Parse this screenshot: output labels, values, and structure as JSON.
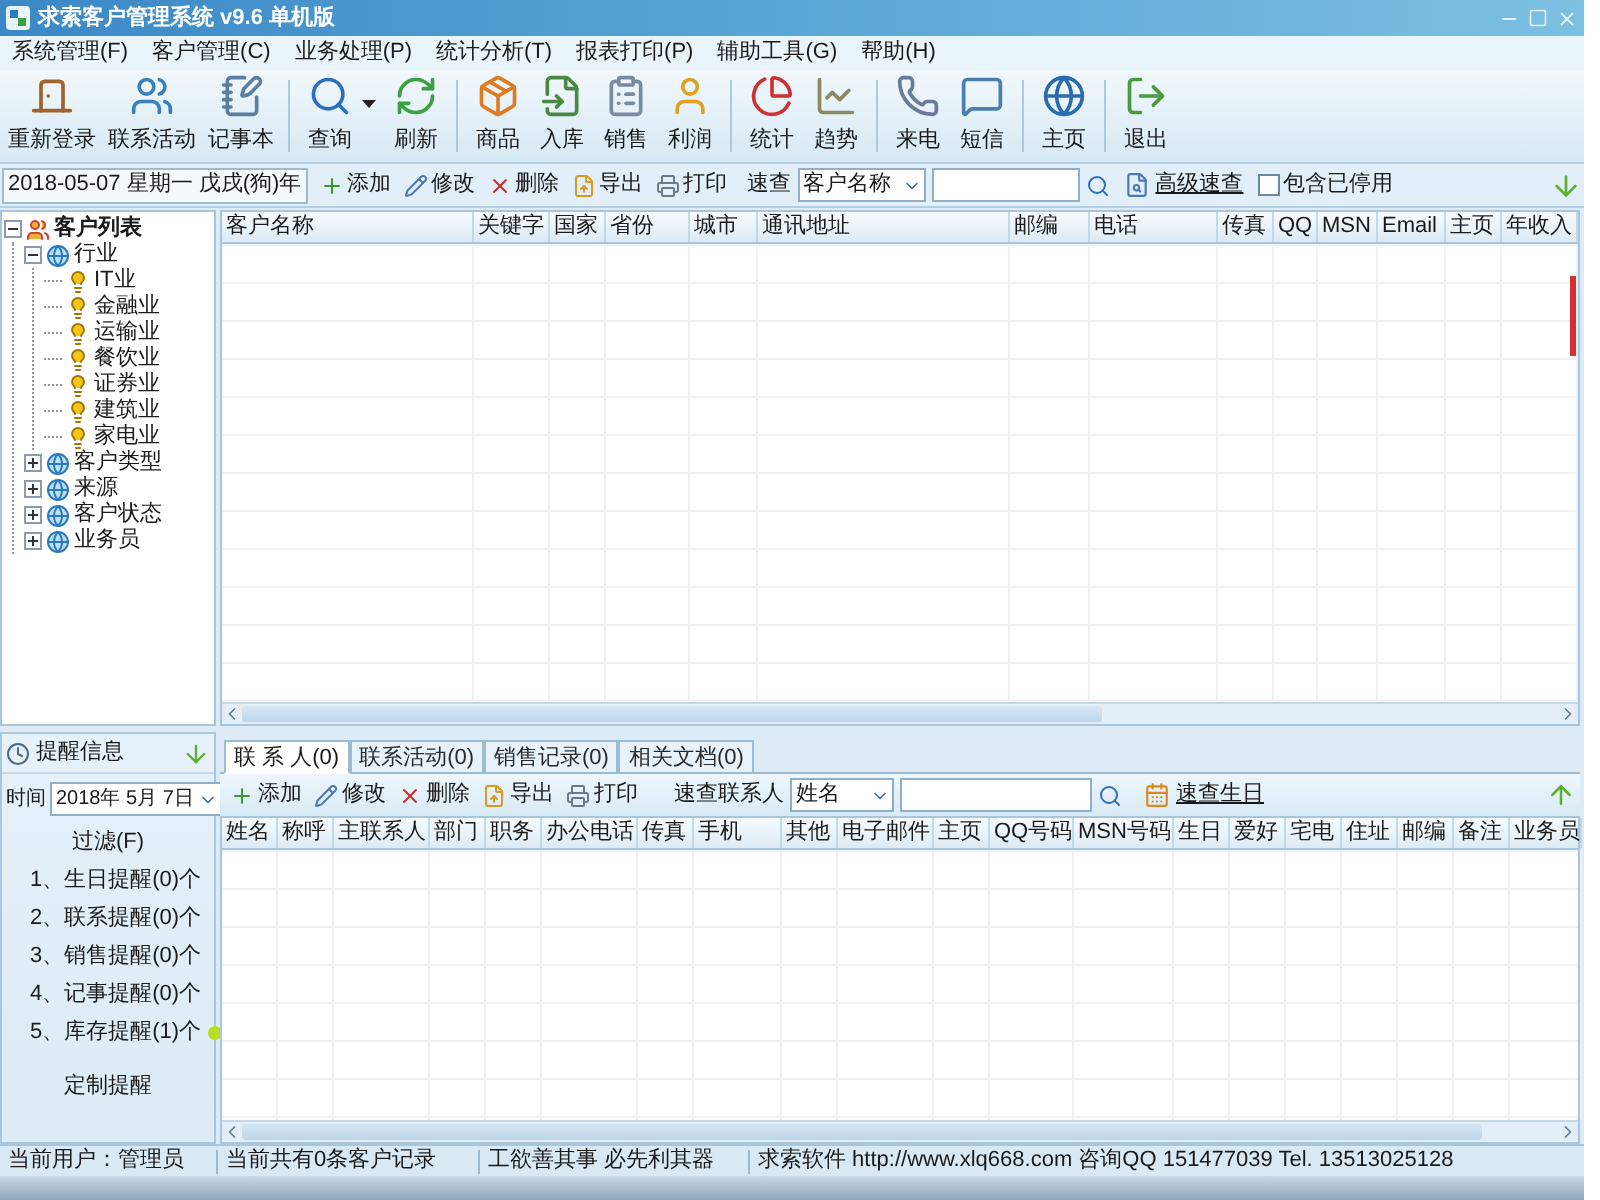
{
  "window": {
    "title": "求索客户管理系统 v9.6 单机版"
  },
  "menu": [
    "系统管理(F)",
    "客户管理(C)",
    "业务处理(P)",
    "统计分析(T)",
    "报表打印(P)",
    "辅助工具(G)",
    "帮助(H)"
  ],
  "toolbar": [
    {
      "items": [
        {
          "label": "重新登录",
          "dropdown": false
        },
        {
          "label": "联系活动",
          "dropdown": false
        },
        {
          "label": "记事本",
          "dropdown": false
        }
      ]
    },
    {
      "items": [
        {
          "label": "查询",
          "dropdown": true
        },
        {
          "label": "刷新",
          "dropdown": false
        }
      ]
    },
    {
      "items": [
        {
          "label": "商品",
          "dropdown": false
        },
        {
          "label": "入库",
          "dropdown": false
        },
        {
          "label": "销售",
          "dropdown": false
        },
        {
          "label": "利润",
          "dropdown": false
        }
      ]
    },
    {
      "items": [
        {
          "label": "统计",
          "dropdown": false
        },
        {
          "label": "趋势",
          "dropdown": false
        }
      ]
    },
    {
      "items": [
        {
          "label": "来电",
          "dropdown": false
        },
        {
          "label": "短信",
          "dropdown": false
        }
      ]
    },
    {
      "items": [
        {
          "label": "主页",
          "dropdown": false
        }
      ]
    },
    {
      "items": [
        {
          "label": "退出",
          "dropdown": false
        }
      ]
    }
  ],
  "filter_bar": {
    "date": "2018-05-07 星期一 戊戌(狗)年",
    "actions": [
      "添加",
      "修改",
      "删除",
      "导出",
      "打印"
    ],
    "quick_search": {
      "label": "速查",
      "field": "客户名称"
    },
    "advanced_search": "高级速查",
    "include_disabled": {
      "label": "包含已停用",
      "checked": false
    }
  },
  "customer_tree": {
    "label": "客户列表",
    "expanded": true,
    "children": [
      {
        "label": "行业",
        "expanded": true,
        "children": [
          {
            "label": "IT业"
          },
          {
            "label": "金融业"
          },
          {
            "label": "运输业"
          },
          {
            "label": "餐饮业"
          },
          {
            "label": "证券业"
          },
          {
            "label": "建筑业"
          },
          {
            "label": "家电业"
          }
        ]
      },
      {
        "label": "客户类型",
        "expanded": false
      },
      {
        "label": "来源",
        "expanded": false
      },
      {
        "label": "客户状态",
        "expanded": false
      },
      {
        "label": "业务员",
        "expanded": false
      }
    ]
  },
  "customer_table": {
    "columns": [
      "客户名称",
      "关键字",
      "国家",
      "省份",
      "城市",
      "通讯地址",
      "邮编",
      "电话",
      "传真",
      "QQ",
      "MSN",
      "Email",
      "主页",
      "年收入"
    ]
  },
  "reminders": {
    "title": "提醒信息",
    "date_label": "时间",
    "date": "2018年 5月 7日",
    "filter": "过滤(F)",
    "items": [
      {
        "text": "1、生日提醒(0)个",
        "alert": false
      },
      {
        "text": "2、联系提醒(0)个",
        "alert": false
      },
      {
        "text": "3、销售提醒(0)个",
        "alert": false
      },
      {
        "text": "4、记事提醒(0)个",
        "alert": false
      },
      {
        "text": "5、库存提醒(1)个",
        "alert": true
      }
    ],
    "customize": "定制提醒"
  },
  "detail": {
    "tabs": [
      {
        "label": "联 系 人(0)",
        "selected": true
      },
      {
        "label": "联系活动(0)",
        "selected": false
      },
      {
        "label": "销售记录(0)",
        "selected": false
      },
      {
        "label": "相关文档(0)",
        "selected": false
      }
    ],
    "actions": [
      "添加",
      "修改",
      "删除",
      "导出",
      "打印"
    ],
    "quick_search": {
      "label": "速查联系人",
      "field": "姓名"
    },
    "birthday_search": "速查生日",
    "columns": [
      "姓名",
      "称呼",
      "主联系人",
      "部门",
      "职务",
      "办公电话",
      "传真",
      "手机",
      "其他",
      "电子邮件",
      "主页",
      "QQ号码",
      "MSN号码",
      "生日",
      "爱好",
      "宅电",
      "住址",
      "邮编",
      "备注",
      "业务员"
    ]
  },
  "status_bar": [
    "当前用户：管理员",
    "当前共有0条客户记录",
    "工欲善其事 必先利其器",
    "求索软件 http://www.xlq668.com 咨询QQ 151477039 Tel. 13513025128"
  ]
}
